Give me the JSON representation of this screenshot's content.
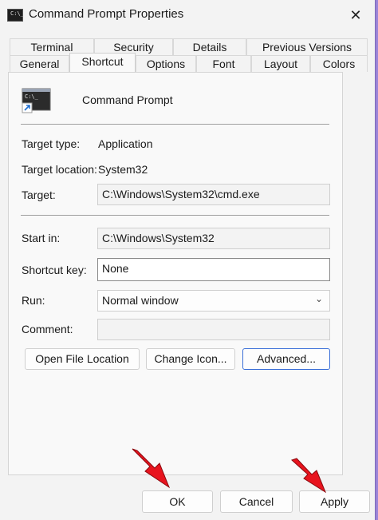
{
  "window": {
    "title": "Command Prompt Properties",
    "close": "✕"
  },
  "tabs_row1": [
    "Terminal",
    "Security",
    "Details",
    "Previous Versions"
  ],
  "tabs_row2": [
    "General",
    "Shortcut",
    "Options",
    "Font",
    "Layout",
    "Colors"
  ],
  "active_tab": "Shortcut",
  "shortcut": {
    "name": "Command Prompt",
    "icon_prompt": "C:\\_",
    "target_type_label": "Target type:",
    "target_type": "Application",
    "target_location_label": "Target location:",
    "target_location": "System32",
    "target_label": "Target:",
    "target": "C:\\Windows\\System32\\cmd.exe",
    "start_in_label": "Start in:",
    "start_in": "C:\\Windows\\System32",
    "shortcut_key_label": "Shortcut key:",
    "shortcut_key": "None",
    "run_label": "Run:",
    "run": "Normal window",
    "comment_label": "Comment:",
    "comment": ""
  },
  "buttons": {
    "open_file_location": "Open File Location",
    "change_icon": "Change Icon...",
    "advanced": "Advanced..."
  },
  "footer": {
    "ok": "OK",
    "cancel": "Cancel",
    "apply": "Apply"
  },
  "colors": {
    "annotation_arrow": "#e8141e",
    "accent": "#3a6fd8"
  }
}
